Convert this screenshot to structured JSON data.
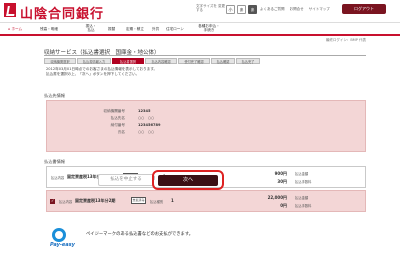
{
  "header": {
    "bank_name": "山陰合同銀行",
    "font_size_label": "文字サイズを 変更する",
    "size_small": "小",
    "size_medium": "あ",
    "size_large": "あ",
    "links": [
      "よくあるご質問",
      "お問合せ",
      "サイトマップ"
    ],
    "logout_label": "ログアウト"
  },
  "nav": {
    "items": [
      {
        "label": "ホーム"
      },
      {
        "label": "残高・明細"
      },
      {
        "label": "振込・\n払込"
      },
      {
        "label": "振替"
      },
      {
        "label": "定期・積立"
      },
      {
        "label": "外貨"
      },
      {
        "label": "住宅ローン"
      },
      {
        "label": "各種お申込・\n手続き"
      }
    ]
  },
  "page": {
    "date_line": "最終ログイン：BMP 代表",
    "title": "収納サービス（払込書選択　国庫金・地公体）",
    "steps": [
      "収納機関選択",
      "払込書情報入力",
      "払込書選択",
      "払込内容確認",
      "受付完了確認",
      "払込確認",
      "払込完了"
    ],
    "current_step": 2,
    "description": [
      "2012年03月01日時点でのお客さまの払込情報を表示しております。",
      "払込書を選択の上、「次へ」ボタンを押下してください。"
    ]
  },
  "payee_info": {
    "heading": "払込先情報",
    "rows": [
      {
        "label": "収納機関番号",
        "value": "12345"
      },
      {
        "label": "払込先名",
        "value": "○○　○○"
      },
      {
        "label": "納付番号",
        "value": "123456789"
      },
      {
        "label": "氏名",
        "value": "○○　○○"
      }
    ]
  },
  "payment_info": {
    "heading": "払込書情報",
    "items": [
      {
        "selected": false,
        "kind_label": "払込内容",
        "name": "固定資産税13年分1期",
        "tag": "支払済み",
        "count_label": "払込種別",
        "count": "1",
        "amount": "900円",
        "fee": "30円",
        "amount_label": "払込金額",
        "fee_label": "払込手数料"
      },
      {
        "selected": true,
        "kind_label": "払込内容",
        "name": "固定資産税13年分2期",
        "tag": "支払済み",
        "count_label": "払込種別",
        "count": "1",
        "amount": "22,000円",
        "fee": "0円",
        "amount_label": "払込金額",
        "fee_label": "払込手数料"
      }
    ]
  },
  "actions": {
    "cancel_label": "払込を中止する",
    "next_label": "次へ"
  },
  "footer": {
    "payeasy_logo": "Pay-easy",
    "note": "ペイジーマークのある払込書などのお支払ができます。"
  },
  "colors": {
    "brand_red": "#c8102e",
    "dark_button": "#3a0f14",
    "highlight_pink": "#f3d6d6"
  }
}
